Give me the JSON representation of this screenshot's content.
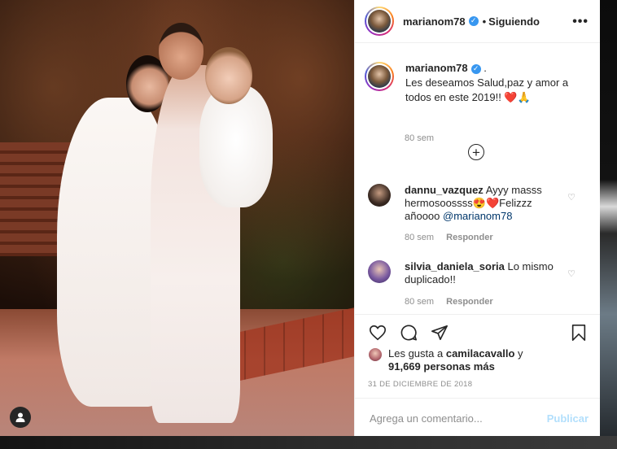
{
  "post": {
    "username": "marianom78",
    "verified_mark": "✓",
    "separator": "•",
    "follow_status": "Siguiendo",
    "more_label": "•••",
    "caption": {
      "username": "marianom78",
      "text": "Les deseamos Salud,paz y amor a todos en este 2019!! ❤️🙏",
      "time": "80 sem"
    },
    "load_more_label": "+",
    "comments": [
      {
        "username": "dannu_vazquez",
        "text_before": "Ayyy masss hermosoossss😍❤️Felizzz añoooo ",
        "mention": "@marianom78",
        "time": "80 sem",
        "reply": "Responder",
        "avatar_color": "#3a2a22"
      },
      {
        "username": "silvia_daniela_soria",
        "text_before": "Lo mismo duplicado!!",
        "mention": "",
        "time": "80 sem",
        "reply": "Responder",
        "avatar_color": "#7a5aa0"
      }
    ],
    "likes": {
      "prefix": "Les gusta a",
      "liker": "camilacavallo",
      "joiner": "y",
      "count": "91,669 personas más"
    },
    "date": "31 DE DICIEMBRE DE 2018",
    "add_comment_placeholder": "Agrega un comentario...",
    "publish_label": "Publicar"
  },
  "icons": {
    "heart": "heart-icon",
    "comment": "comment-icon",
    "share": "share-icon",
    "save": "bookmark-icon",
    "small_heart": "♡"
  },
  "colors": {
    "verified": "#3897f0",
    "publish_disabled": "#b2dffc",
    "secondary_text": "#8e8e8e",
    "mention": "#00376b"
  }
}
